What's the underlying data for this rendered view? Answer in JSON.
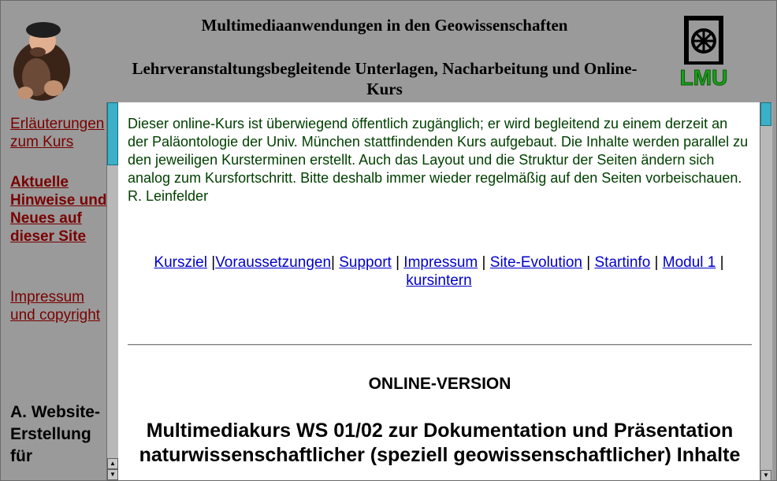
{
  "header": {
    "title": "Multimediaanwendungen in den Geowissenschaften",
    "subtitle": "Lehrveranstaltungsbegleitende Unterlagen, Nacharbeitung und Online-Kurs",
    "logo_right_text": "LMU"
  },
  "sidebar": {
    "link_kurs": "Erläuterungen zum Kurs",
    "link_news": "Aktuelle Hinweise und Neues auf dieser Site",
    "link_impressum": "Impressum und copyright",
    "section_a": "A. Website-Erstellung für"
  },
  "main": {
    "intro": "Dieser online-Kurs ist überwiegend öffentlich zugänglich; er wird begleitend zu einem derzeit an der Paläontologie der Univ. München stattfindenden Kurs aufgebaut. Die Inhalte werden parallel zu den jeweiligen Kursterminen erstellt. Auch das Layout und die Struktur der Seiten ändern sich analog zum Kursfortschritt. Bitte deshalb immer wieder regelmäßig auf den Seiten vorbeischauen. R. Leinfelder",
    "nav": {
      "kursziel": "Kursziel",
      "voraussetzungen": "Voraussetzungen",
      "support": "Support",
      "impressum": "Impressum",
      "site_evolution": "Site-Evolution",
      "startinfo": "Startinfo",
      "modul1": "Modul 1",
      "kursintern": "kursintern"
    },
    "online_version": "ONLINE-VERSION",
    "course_title": "Multimediakurs WS 01/02 zur Dokumentation und Präsentation naturwissenschaftlicher (speziell geowissenschaftlicher) Inhalte"
  },
  "colors": {
    "background": "#9a9a9a",
    "sidebar_link": "#7a0000",
    "intro_text": "#004000",
    "nav_link": "#0000cc",
    "scroll_thumb": "#3bb0c8",
    "lmu_green": "#1aa01a"
  }
}
